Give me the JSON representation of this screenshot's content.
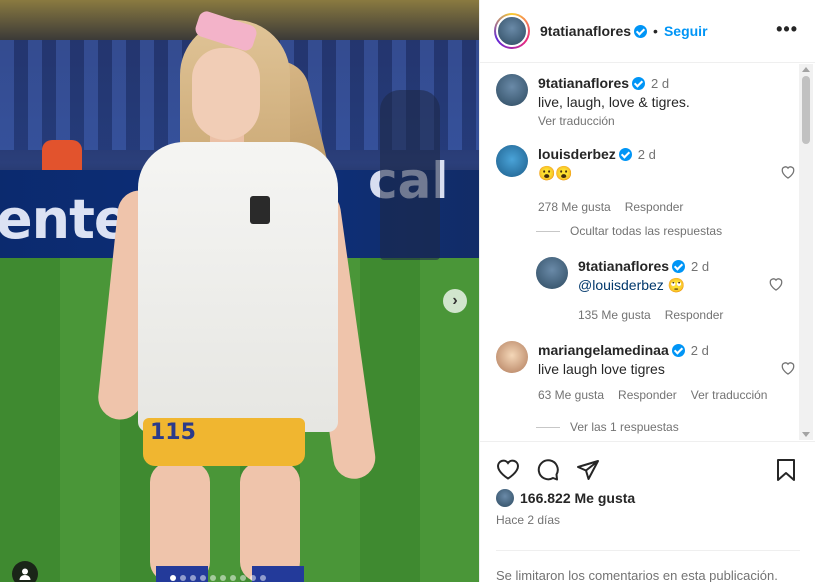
{
  "post": {
    "username": "9tatianaflores",
    "follow_label": "Seguir",
    "more_label": "•••"
  },
  "photo": {
    "banner_left": "ente.",
    "banner_right": "cal",
    "shorts_number": "115",
    "next_icon": "›"
  },
  "caption": {
    "username": "9tatianaflores",
    "time": "2 d",
    "text": "live, laugh, love & tigres.",
    "translate": "Ver traducción"
  },
  "comments": [
    {
      "username": "louisderbez",
      "time": "2 d",
      "text": "😮😮",
      "likes": "278 Me gusta",
      "reply": "Responder"
    },
    {
      "username": "mariangelamedinaa",
      "time": "2 d",
      "text": "live laugh love tigres",
      "likes": "63 Me gusta",
      "reply": "Responder",
      "translate": "Ver traducción"
    }
  ],
  "replies": {
    "hide_label": "Ocultar todas las respuestas",
    "items": [
      {
        "username": "9tatianaflores",
        "time": "2 d",
        "mention": "@louisderbez",
        "emoji": "🙄",
        "likes": "135 Me gusta",
        "reply": "Responder"
      }
    ],
    "view_more": "Ver las 1 respuestas"
  },
  "footer": {
    "likes": "166.822 Me gusta",
    "time_ago": "Hace 2 días",
    "comments_closed": "Se limitaron los comentarios en esta publicación."
  },
  "colors": {
    "accent": "#0095f6",
    "muted": "#737373",
    "text": "#262626"
  },
  "icons": [
    "heart-icon",
    "comment-icon",
    "share-icon",
    "bookmark-icon",
    "verified-icon",
    "more-icon",
    "chevron-right-icon",
    "user-tag-icon"
  ]
}
